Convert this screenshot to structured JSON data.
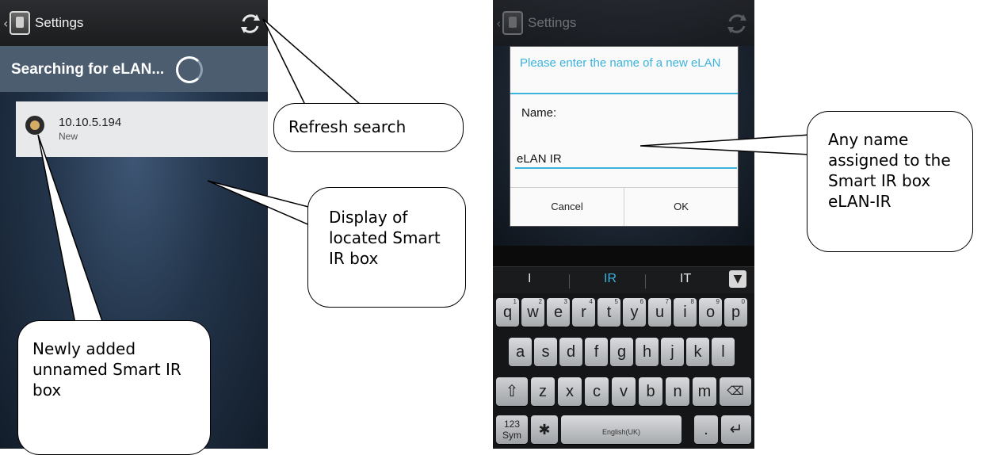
{
  "left_screen": {
    "header": {
      "back_glyph": "‹",
      "title": "Settings",
      "refresh_icon": "refresh-icon"
    },
    "subheader": {
      "title": "Searching for eLAN..."
    },
    "device": {
      "ip": "10.10.5.194",
      "status": "New"
    }
  },
  "callouts": {
    "refresh": "Refresh search",
    "display": "Display of located Smart IR box",
    "new_box": "Newly added unnamed Smart IR box",
    "any_name": "Any name assigned to the Smart IR box eLAN-IR"
  },
  "right_screen": {
    "header": {
      "title": "Settings"
    },
    "dialog": {
      "title": "Please enter the name of a new eLAN",
      "name_label": "Name:",
      "input_value": "eLAN IR",
      "cancel_label": "Cancel",
      "ok_label": "OK"
    },
    "suggestions": [
      "I",
      "IR",
      "IT"
    ],
    "keyboard": {
      "row1": [
        "q",
        "w",
        "e",
        "r",
        "t",
        "y",
        "u",
        "i",
        "o",
        "p"
      ],
      "row1_hints": [
        "1",
        "2",
        "3",
        "4",
        "5",
        "6",
        "7",
        "8",
        "9",
        "0"
      ],
      "row2": [
        "a",
        "s",
        "d",
        "f",
        "g",
        "h",
        "j",
        "k",
        "l"
      ],
      "row3": [
        "z",
        "x",
        "c",
        "v",
        "b",
        "n",
        "m"
      ],
      "sym_label": "123 Sym",
      "space_label": "English(UK)",
      "period_label": "."
    }
  },
  "colors": {
    "accent": "#3cb2dc",
    "radio_fill": "#d6ad65"
  }
}
